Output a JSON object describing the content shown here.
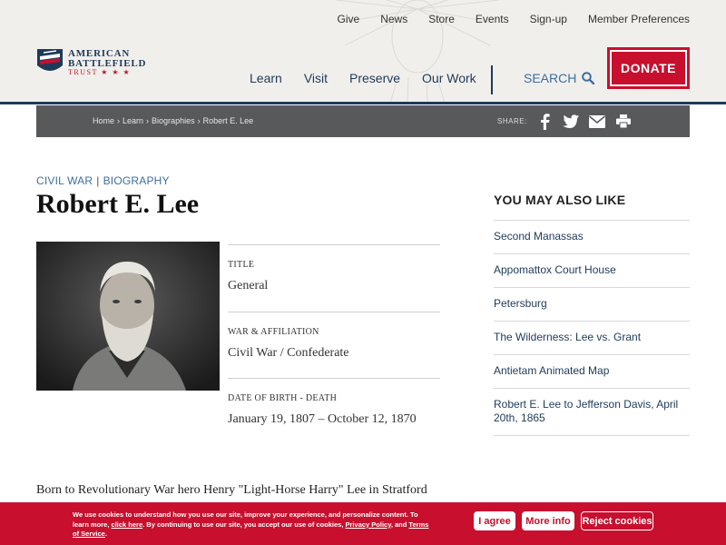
{
  "util_nav": [
    "Give",
    "News",
    "Store",
    "Events",
    "Sign-up",
    "Member Preferences"
  ],
  "logo": {
    "line1": "AMERICAN",
    "line2": "BATTLEFIELD",
    "line3": "TRUST ★ ★ ★"
  },
  "main_nav": [
    "Learn",
    "Visit",
    "Preserve",
    "Our Work"
  ],
  "search_label": "SEARCH",
  "donate_label": "DONATE",
  "breadcrumb": [
    "Home",
    "Learn",
    "Biographies",
    "Robert E. Lee"
  ],
  "share_label": "SHARE:",
  "share_icons": [
    "facebook-icon",
    "twitter-icon",
    "email-icon",
    "print-icon"
  ],
  "kicker": {
    "first": "CIVIL WAR",
    "separator": "|",
    "second": "BIOGRAPHY"
  },
  "title": "Robert E. Lee",
  "facts": [
    {
      "label": "TITLE",
      "value": "General"
    },
    {
      "label": "WAR & AFFILIATION",
      "value": "Civil War / Confederate"
    },
    {
      "label": "DATE OF BIRTH - DEATH",
      "value": "January 19, 1807 – October 12, 1870"
    }
  ],
  "sidebar": {
    "title": "YOU MAY ALSO LIKE",
    "items": [
      "Second Manassas",
      "Appomattox Court House",
      "Petersburg",
      "The Wilderness: Lee vs. Grant",
      "Antietam Animated Map",
      "Robert E. Lee to Jefferson Davis, April 20th, 1865"
    ]
  },
  "body_text": "Born to Revolutionary War hero Henry \"Light-Horse Harry\" Lee in Stratford Hall,",
  "cookie": {
    "text_a": "We use cookies to understand how you use our site, improve your experience, and personalize content. To learn more, ",
    "link_click": "click here",
    "text_b": ". By continuing to use our site, you accept our use of cookies, ",
    "link_privacy": "Privacy Policy",
    "text_c": ", and ",
    "link_terms": "Terms of Service",
    "text_d": ".",
    "agree": "I agree",
    "more": "More info",
    "reject": "Reject cookies"
  },
  "colors": {
    "brand_red": "#c8102e",
    "navy": "#1e3a5a",
    "link_blue": "#3d6ea0",
    "bar_gray": "#58595b"
  }
}
